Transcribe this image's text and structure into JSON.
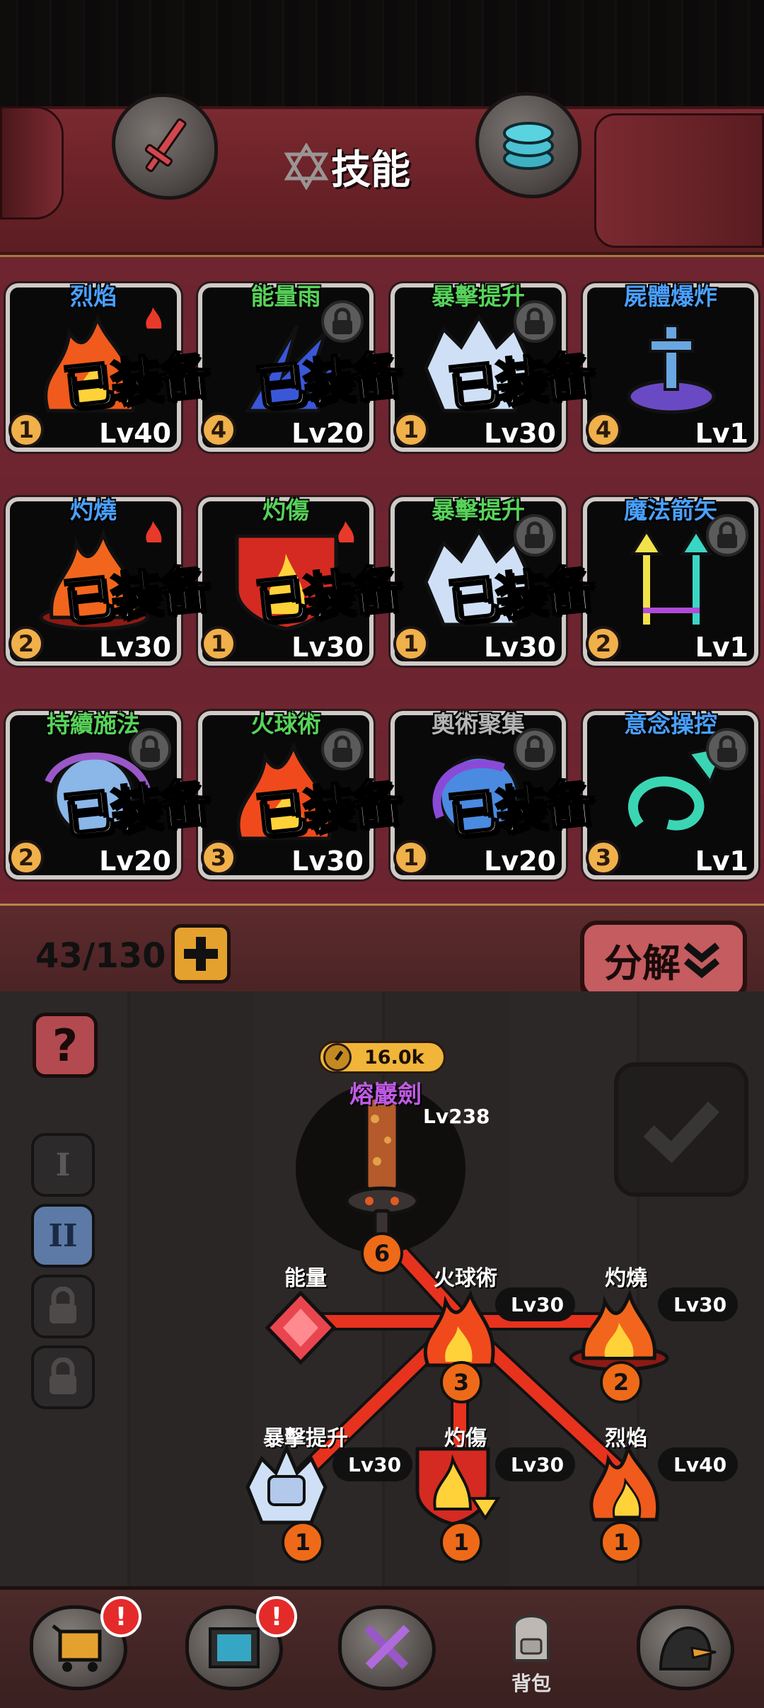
{
  "header": {
    "title": "技能",
    "left_button_icon": "sword-icon",
    "right_button_icon": "stack-icon"
  },
  "skill_cards": [
    {
      "name": "烈焰",
      "name_color": "#4aa0ff",
      "icon": "flame-icon",
      "badge": "fire",
      "equipped": "已装备",
      "qty": "1",
      "level": "Lv40"
    },
    {
      "name": "能量雨",
      "name_color": "#58d25a",
      "icon": "energy-rain-icon",
      "badge": "lock",
      "equipped": "已装备",
      "qty": "4",
      "level": "Lv20"
    },
    {
      "name": "暴擊提升",
      "name_color": "#58d25a",
      "icon": "fist-icon",
      "badge": "lock",
      "equipped": "已装备",
      "qty": "1",
      "level": "Lv30"
    },
    {
      "name": "屍體爆炸",
      "name_color": "#4aa0ff",
      "icon": "grave-icon",
      "badge": "none",
      "equipped": "",
      "qty": "4",
      "level": "Lv1"
    },
    {
      "name": "灼燒",
      "name_color": "#4aa0ff",
      "icon": "burning-icon",
      "badge": "fire",
      "equipped": "已装备",
      "qty": "2",
      "level": "Lv30"
    },
    {
      "name": "灼傷",
      "name_color": "#58d25a",
      "icon": "burn-shield-icon",
      "badge": "fire",
      "equipped": "已装备",
      "qty": "1",
      "level": "Lv30"
    },
    {
      "name": "暴擊提升",
      "name_color": "#58d25a",
      "icon": "fist-icon",
      "badge": "lock",
      "equipped": "已装备",
      "qty": "1",
      "level": "Lv30"
    },
    {
      "name": "魔法箭矢",
      "name_color": "#4aa0ff",
      "icon": "magic-arrows-icon",
      "badge": "lock",
      "equipped": "",
      "qty": "2",
      "level": "Lv1"
    },
    {
      "name": "持續施法",
      "name_color": "#58d25a",
      "icon": "orb-icon",
      "badge": "lock",
      "equipped": "已装备",
      "qty": "2",
      "level": "Lv20"
    },
    {
      "name": "火球術",
      "name_color": "#58d25a",
      "icon": "fireball-icon",
      "badge": "lock",
      "equipped": "已装备",
      "qty": "3",
      "level": "Lv30"
    },
    {
      "name": "奧術聚集",
      "name_color": "#b5b5b5",
      "icon": "arcane-orb-icon",
      "badge": "lock",
      "equipped": "已装备",
      "qty": "1",
      "level": "Lv20"
    },
    {
      "name": "意念操控",
      "name_color": "#4aa0ff",
      "icon": "spiral-arrow-icon",
      "badge": "lock",
      "equipped": "",
      "qty": "3",
      "level": "Lv1"
    }
  ],
  "inventory": {
    "count": "43/130",
    "decompose_label": "分解"
  },
  "side_tabs": [
    "I",
    "II"
  ],
  "weapon": {
    "power": "16.0k",
    "name": "熔巖劍",
    "level": "Lv238",
    "slot_count": "6"
  },
  "tree_nodes": {
    "energy": {
      "name": "能量"
    },
    "fireball": {
      "name": "火球術",
      "level": "Lv30",
      "count": "3"
    },
    "burning": {
      "name": "灼燒",
      "level": "Lv30",
      "count": "2"
    },
    "crit": {
      "name": "暴擊提升",
      "level": "Lv30",
      "count": "1"
    },
    "burn": {
      "name": "灼傷",
      "level": "Lv30",
      "count": "1"
    },
    "flame": {
      "name": "烈焰",
      "level": "Lv40",
      "count": "1"
    }
  },
  "bottom_nav": [
    {
      "icon": "cart-icon",
      "alert": "!"
    },
    {
      "icon": "map-icon",
      "alert": "!"
    },
    {
      "icon": "crossed-swords-icon",
      "alert": ""
    },
    {
      "icon": "backpack-icon",
      "label": "背包"
    },
    {
      "icon": "hooded-hero-icon",
      "alert": ""
    }
  ]
}
